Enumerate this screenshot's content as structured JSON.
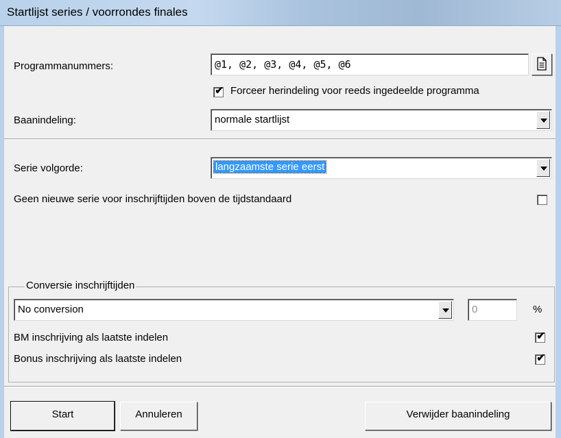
{
  "window": {
    "title": "Startlijst series / voorrondes finales"
  },
  "programmanummers": {
    "label": "Programmanummers:",
    "value": "@1, @2, @3, @4, @5, @6",
    "button_icon": "document-icon"
  },
  "forceer": {
    "label": "Forceer herindeling voor reeds ingedeelde programma",
    "checked": true,
    "mark": "✔"
  },
  "baanindeling": {
    "label": "Baanindeling:",
    "value": "normale startlijst"
  },
  "serie_volgorde": {
    "label": "Serie volgorde:",
    "value": "langzaamste serie eerst"
  },
  "geen_nieuwe_serie": {
    "label": "Geen nieuwe serie voor inschrijftijden boven de tijdstandaard",
    "checked": false,
    "mark": ""
  },
  "conversie": {
    "group_title": "Conversie inschrijftijden",
    "select_value": "No conversion",
    "percent_value": "0",
    "percent_unit": "%"
  },
  "bm_inschrijving": {
    "label": "BM inschrijving als laatste indelen",
    "checked": true,
    "mark": "✔"
  },
  "bonus_inschrijving": {
    "label": "Bonus inschrijving als laatste indelen",
    "checked": true,
    "mark": "✔"
  },
  "buttons": {
    "start": "Start",
    "annuleren": "Annuleren",
    "verwijder": "Verwijder baanindeling"
  }
}
